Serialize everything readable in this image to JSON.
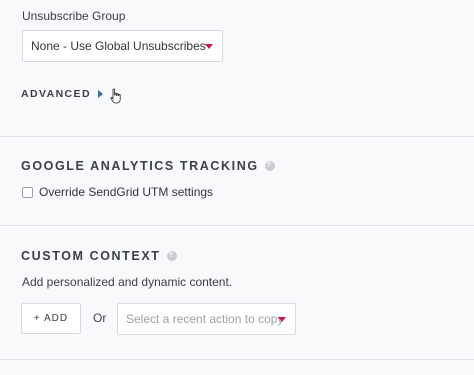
{
  "unsubscribe": {
    "label": "Unsubscribe Group",
    "selected": "None - Use Global Unsubscribes"
  },
  "advanced": {
    "label": "ADVANCED"
  },
  "analytics": {
    "heading": "GOOGLE ANALYTICS TRACKING",
    "help": "?",
    "checkbox_label": "Override SendGrid UTM settings",
    "checked": false
  },
  "custom_context": {
    "heading": "CUSTOM CONTEXT",
    "help": "?",
    "description": "Add personalized and dynamic content.",
    "add_label": "+ ADD",
    "or_label": "Or",
    "recent_placeholder": "Select a recent action to copy"
  },
  "colors": {
    "accent": "#c2185b",
    "background": "#f8f9fa",
    "border": "#d7dbdf"
  }
}
